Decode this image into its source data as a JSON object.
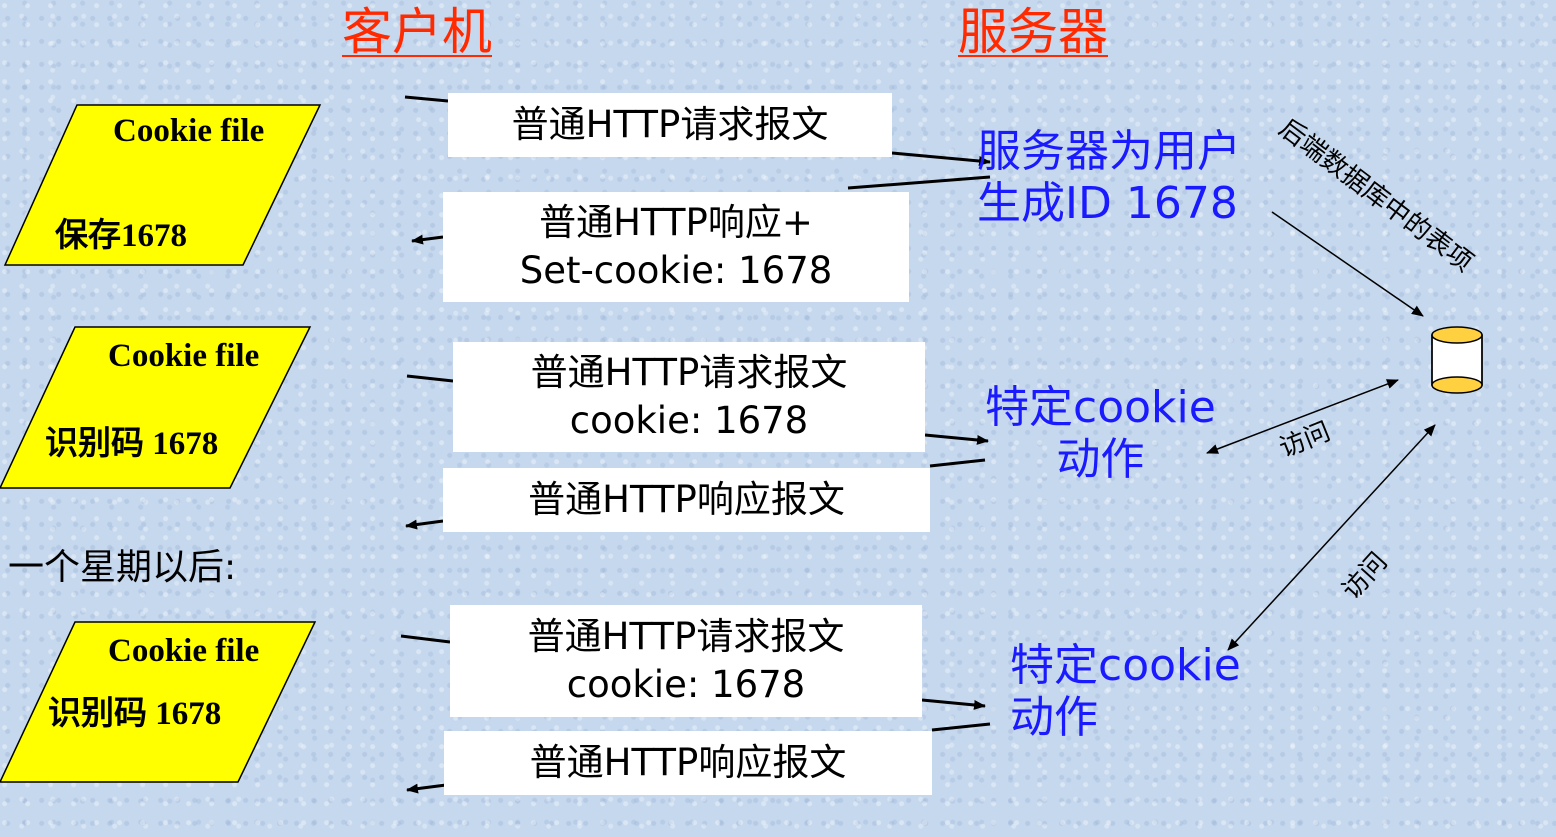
{
  "headings": {
    "client": "客户机",
    "server": "服务器"
  },
  "cookie_files": [
    {
      "title": "Cookie file",
      "content": "保存1678"
    },
    {
      "title": "Cookie file",
      "content": "识别码 1678"
    },
    {
      "title": "Cookie file",
      "content": "识别码 1678"
    }
  ],
  "messages": {
    "req1": "普通HTTP请求报文",
    "resp1_line1": "普通HTTP响应+",
    "resp1_line2": "Set-cookie: 1678",
    "req2_line1": "普通HTTP请求报文",
    "req2_line2": "cookie: 1678",
    "resp2": "普通HTTP响应报文",
    "req3_line1": "普通HTTP请求报文",
    "req3_line2": "cookie: 1678",
    "resp3": "普通HTTP响应报文"
  },
  "server_notes": {
    "create_id_line1": "服务器为用户",
    "create_id_line2": "生成ID 1678",
    "action1_line1": "特定cookie",
    "action1_line2": "动作",
    "action2_line1": "特定cookie",
    "action2_line2": "动作"
  },
  "one_week_later": "一个星期以后:",
  "database_label": "后端数据库中的表项",
  "access_label_1": "访问",
  "access_label_2": "访问",
  "colors": {
    "heading": "#ff2a00",
    "server_text": "#1a1aff",
    "cookie_file_fill": "#ffff00",
    "database_fill": "#ffd040",
    "background": "#c6d8ee"
  },
  "icons": [
    "database-icon"
  ]
}
